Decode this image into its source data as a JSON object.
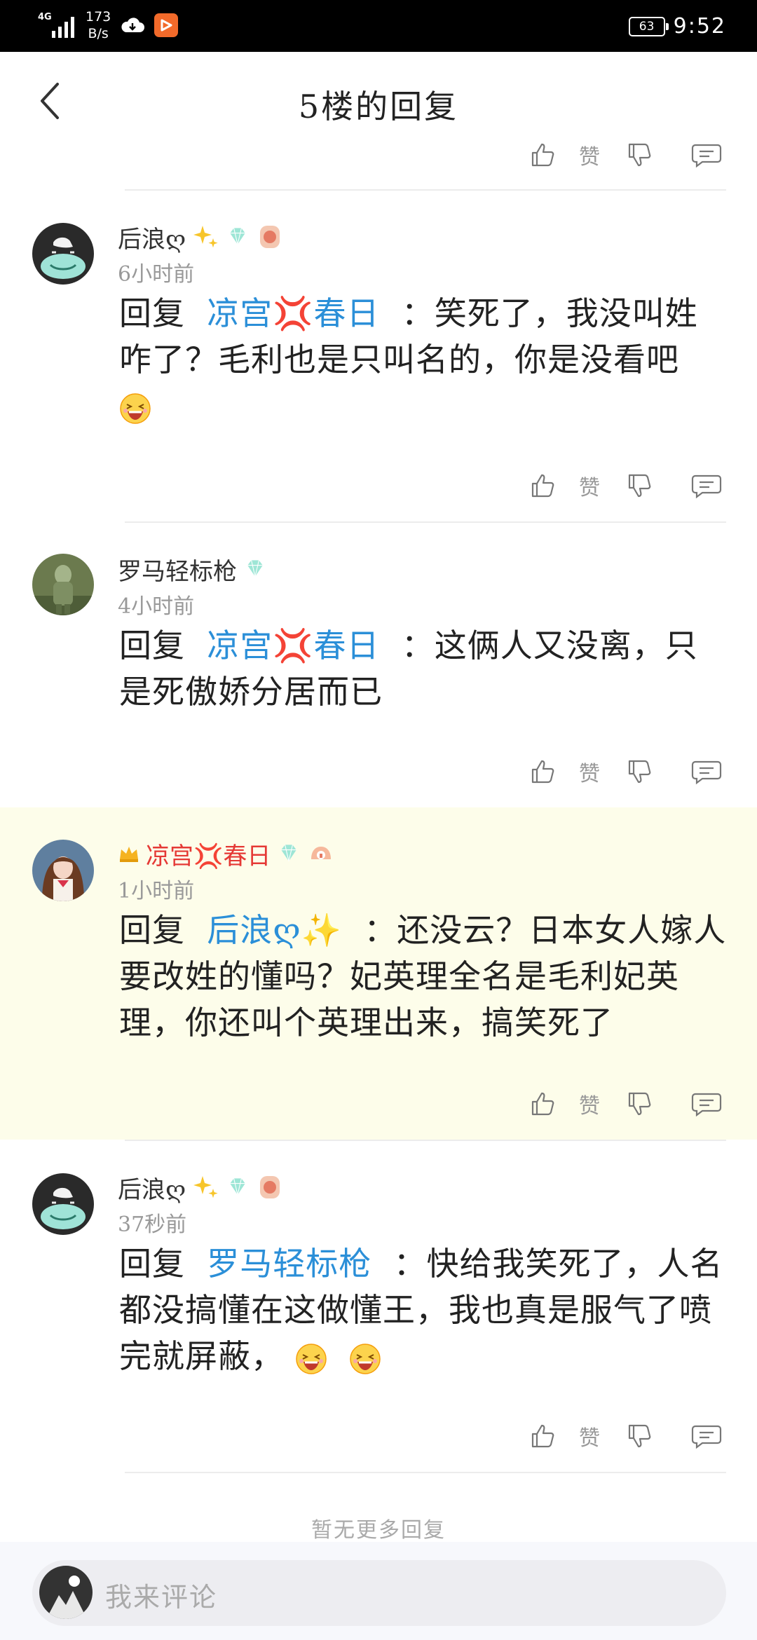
{
  "status_bar": {
    "network": "4G",
    "speed_value": "173",
    "speed_unit": "B/s",
    "battery": "63",
    "time": "9:52"
  },
  "header": {
    "title": "5楼的回复"
  },
  "action_labels": {
    "like_text": "赞"
  },
  "comments": [
    {
      "username": "后浪ღ",
      "time": "6小时前",
      "reply_prefix": "回复",
      "reply_to": "凉宫💢春日",
      "text": "：笑死了，我没叫姓咋了？毛利也是只叫名的，你是没看吧",
      "highlighted": false
    },
    {
      "username": "罗马轻标枪",
      "time": "4小时前",
      "reply_prefix": "回复",
      "reply_to": "凉宫💢春日",
      "text": "：这俩人又没离，只是死傲娇分居而已",
      "highlighted": false
    },
    {
      "username": "凉宫💢春日",
      "time": "1小时前",
      "reply_prefix": "回复",
      "reply_to": "后浪ღ✨",
      "text": "：还没云？日本女人嫁人要改姓的懂吗？妃英理全名是毛利妃英理，你还叫个英理出来，搞笑死了",
      "highlighted": true
    },
    {
      "username": "后浪ღ",
      "time": "37秒前",
      "reply_prefix": "回复",
      "reply_to": "罗马轻标枪",
      "text": "：快给我笑死了，人名都没搞懂在这做懂王，我也真是服气了喷完就屏蔽，",
      "highlighted": false
    }
  ],
  "footer": {
    "no_more": "暂无更多回复",
    "comment_placeholder": "我来评论"
  },
  "colors": {
    "link": "#2b8fd8",
    "highlight_bg": "#fdfdea",
    "vip_name": "#e53935"
  },
  "icons": [
    "back-arrow-icon",
    "thumbs-up-icon",
    "thumbs-down-icon",
    "reply-bubble-icon",
    "sparkle-icon",
    "diamond-badge-icon",
    "level-badge-icon",
    "crown-icon",
    "laugh-emoji-icon"
  ]
}
